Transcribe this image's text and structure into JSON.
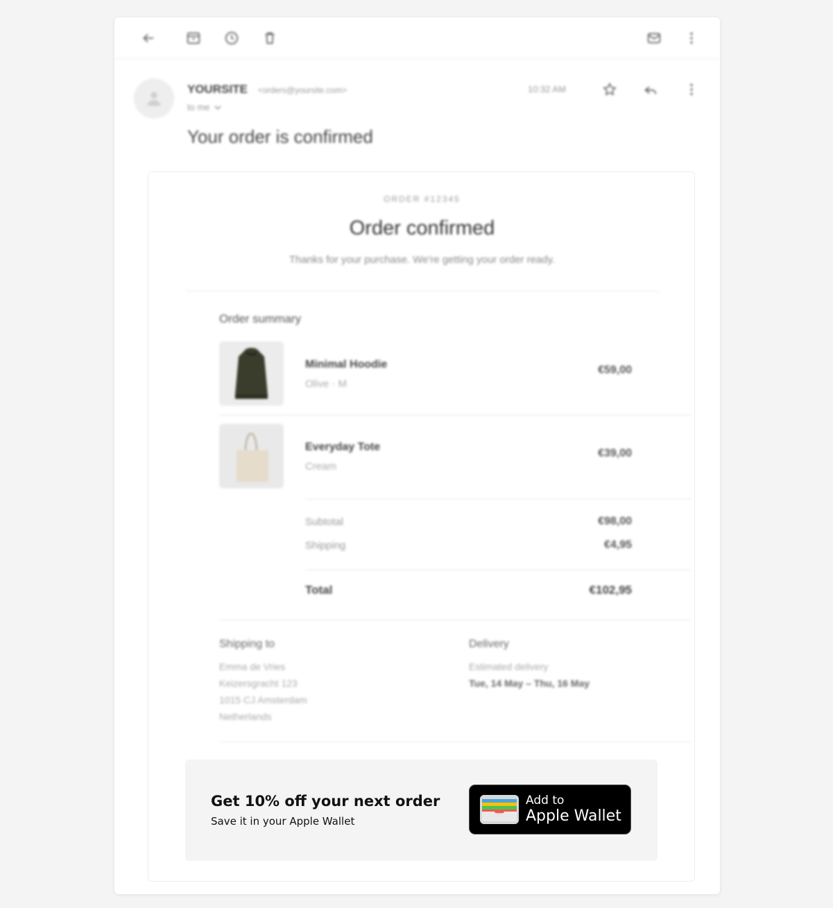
{
  "toolbar": {
    "icons": [
      "back-arrow-icon",
      "archive-icon",
      "snooze-clock-icon",
      "trash-icon",
      "mark-unread-icon",
      "more-vertical-icon"
    ]
  },
  "email": {
    "sender_name": "YOURSITE",
    "sender_email": "<orders@yoursite.com>",
    "recipient": "to me",
    "time": "10:32 AM",
    "subject": "Your order is confirmed"
  },
  "order": {
    "number": "ORDER #12345",
    "title": "Order confirmed",
    "subtitle": "Thanks for your purchase. We're getting your order ready.",
    "summary_title": "Order summary",
    "items": [
      {
        "name": "Minimal Hoodie",
        "variant": "Olive · M",
        "price": "€59,00",
        "image": "hoodie-image",
        "color": "#3a3d2c"
      },
      {
        "name": "Everyday Tote",
        "variant": "Cream",
        "price": "€39,00",
        "image": "tote-image",
        "color": "#e6dccb"
      }
    ],
    "subtotal_label": "Subtotal",
    "subtotal_value": "€98,00",
    "shipping_label": "Shipping",
    "shipping_value": "€4,95",
    "total_label": "Total",
    "total_value": "€102,95"
  },
  "shipping": {
    "title": "Shipping to",
    "name": "Emma de Vries",
    "street": "Keizersgracht 123",
    "city": "1015 CJ Amsterdam",
    "country": "Netherlands"
  },
  "delivery": {
    "title": "Delivery",
    "label": "Estimated delivery",
    "range": "Tue, 14 May – Thu, 16 May"
  },
  "promo": {
    "title": "Get 10% off your next order",
    "subtitle": "Save it in your Apple Wallet",
    "button_small": "Add to",
    "button_big": "Apple Wallet"
  },
  "colors": {
    "wallet_stripes": [
      "#4aa3df",
      "#f4c300",
      "#4cc25a",
      "#f05a4b"
    ]
  }
}
